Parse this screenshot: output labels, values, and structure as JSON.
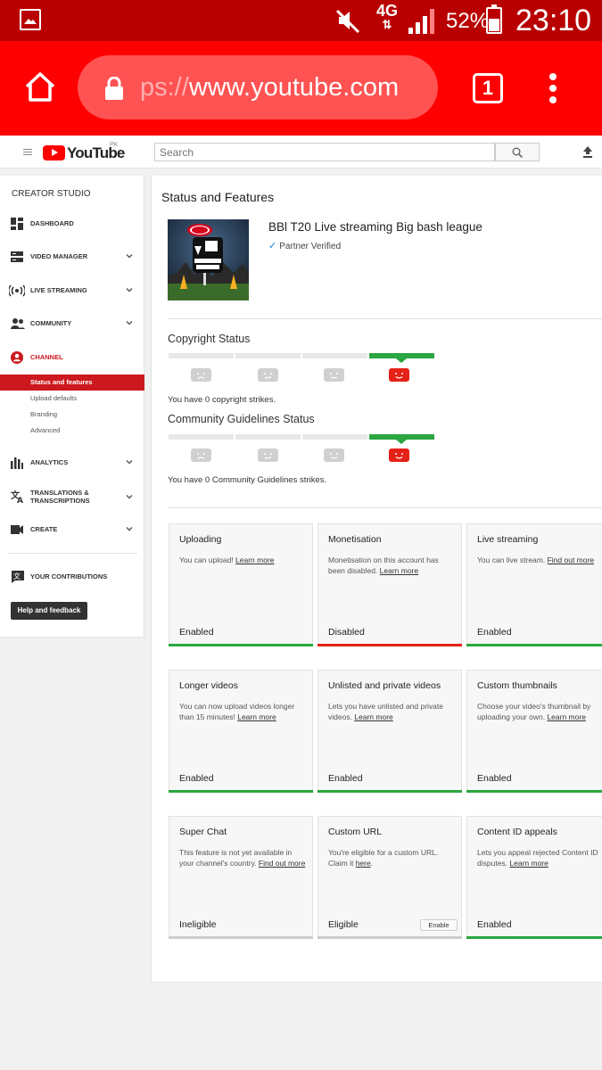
{
  "status_bar": {
    "network": "4G",
    "network_arrows": "⇅",
    "battery_percent": "52%",
    "time": "23:10"
  },
  "browser": {
    "url_faded": "ps://",
    "url_main": "www.youtube.com",
    "tab_count": "1"
  },
  "header": {
    "logo_text": "YouTube",
    "country_code": "PK",
    "search_placeholder": "Search"
  },
  "sidebar": {
    "title": "CREATOR STUDIO",
    "items": [
      {
        "label": "DASHBOARD",
        "icon": "dashboard-icon",
        "has_chevron": false
      },
      {
        "label": "VIDEO MANAGER",
        "icon": "video-manager-icon",
        "has_chevron": true
      },
      {
        "label": "LIVE STREAMING",
        "icon": "live-streaming-icon",
        "has_chevron": true
      },
      {
        "label": "COMMUNITY",
        "icon": "community-icon",
        "has_chevron": true
      },
      {
        "label": "CHANNEL",
        "icon": "channel-icon",
        "has_chevron": false,
        "active": true
      }
    ],
    "channel_sub": [
      "Status and features",
      "Upload defaults",
      "Branding",
      "Advanced"
    ],
    "items2": [
      {
        "label": "ANALYTICS",
        "icon": "analytics-icon"
      },
      {
        "label": "TRANSLATIONS &",
        "label2": "TRANSCRIPTIONS",
        "icon": "translations-icon"
      },
      {
        "label": "CREATE",
        "icon": "create-icon"
      }
    ],
    "contributions": "YOUR CONTRIBUTIONS",
    "help": "Help and feedback"
  },
  "main": {
    "title": "Status and Features",
    "channel_name": "BBl T20 Live streaming Big bash league",
    "verified": "Partner Verified",
    "copyright": {
      "title": "Copyright Status",
      "text": "You have 0 copyright strikes.",
      "level": 4
    },
    "community": {
      "title": "Community Guidelines Status",
      "text": "You have 0 Community Guidelines strikes.",
      "level": 4
    },
    "cards": [
      {
        "title": "Uploading",
        "desc": "You can upload! ",
        "link": "Learn more",
        "desc_after": "",
        "status": "Enabled",
        "color": "#2ba640"
      },
      {
        "title": "Monetisation",
        "desc": "Monetisation on this account has been disabled. ",
        "link": "Learn more",
        "desc_after": "",
        "status": "Disabled",
        "color": "#e62117"
      },
      {
        "title": "Live streaming",
        "desc": "You can live stream. ",
        "link": "Find out more",
        "desc_after": "",
        "status": "Enabled",
        "color": "#2ba640"
      },
      {
        "title": "Longer videos",
        "desc": "You can now upload videos longer than 15 minutes! ",
        "link": "Learn more",
        "desc_after": "",
        "status": "Enabled",
        "color": "#2ba640"
      },
      {
        "title": "Unlisted and private videos",
        "desc": "Lets you have unlisted and private videos. ",
        "link": "Learn more",
        "desc_after": "",
        "status": "Enabled",
        "color": "#2ba640"
      },
      {
        "title": "Custom thumbnails",
        "desc": "Choose your video's thumbnail by uploading your own. ",
        "link": "Learn more",
        "desc_after": "",
        "status": "Enabled",
        "color": "#2ba640"
      },
      {
        "title": "Super Chat",
        "desc": "This feature is not yet available in your channel's country. ",
        "link": "Find out more",
        "desc_after": "",
        "status": "Ineligible",
        "color": "#cccccc"
      },
      {
        "title": "Custom URL",
        "desc": "You're eligible for a custom URL. Claim it ",
        "link": "here",
        "desc_after": ".",
        "status": "Eligible",
        "color": "#cccccc",
        "button": "Enable"
      },
      {
        "title": "Content ID appeals",
        "desc": "Lets you appeal rejected Content ID disputes. ",
        "link": "Learn more",
        "desc_after": "",
        "status": "Enabled",
        "color": "#2ba640"
      }
    ]
  },
  "colors": {
    "status_bar": "#b90000",
    "browser_bar": "#ff0000",
    "active_red": "#cc181e",
    "enabled_green": "#2ba640",
    "disabled_red": "#e62117"
  }
}
